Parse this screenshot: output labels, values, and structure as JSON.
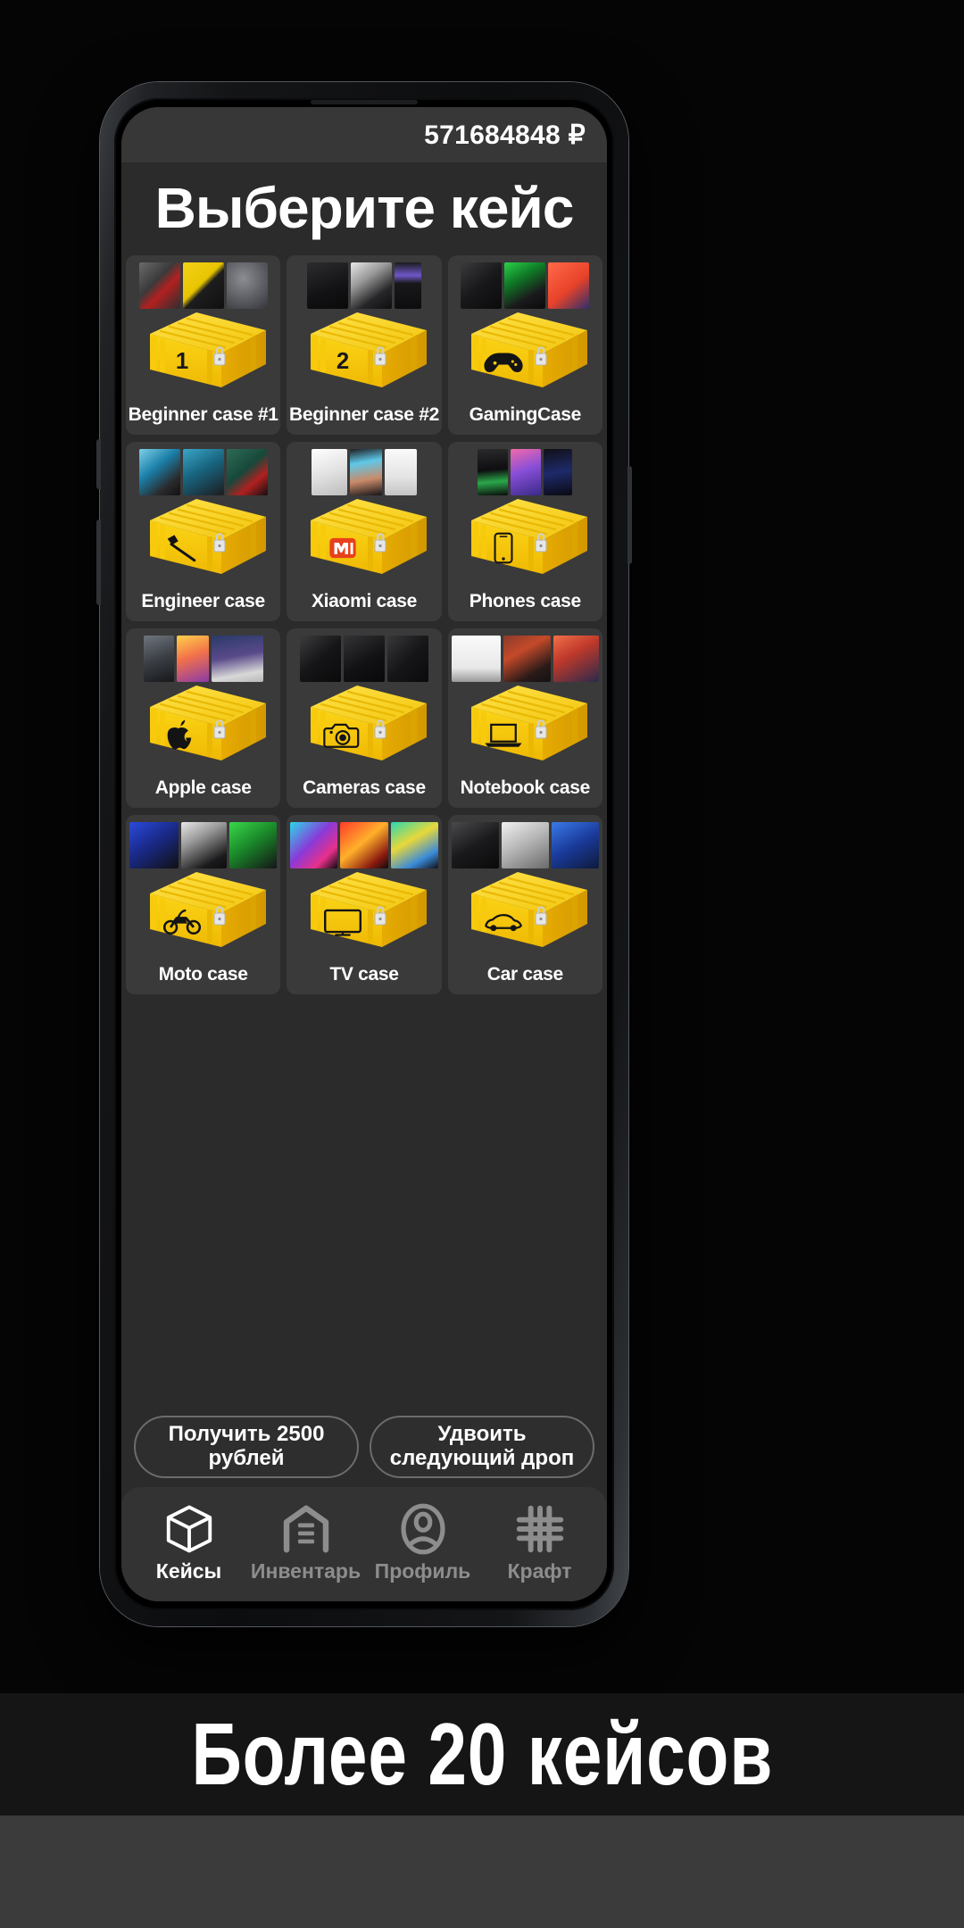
{
  "app": {
    "balance": "571684848 ₽",
    "screen_title": "Выберите кейс"
  },
  "colors": {
    "screen_bg": "#2b2b2b",
    "card_bg": "#3a3a3a",
    "statusbar_bg": "#373737",
    "navbar_bg": "#333333",
    "case_yellow": "#f5cc12",
    "case_yellow_light": "#ffd91f",
    "case_yellow_dark": "#e0a800",
    "text_primary": "#ffffff",
    "text_muted": "#8d8d8d",
    "promo_bg": "#151515"
  },
  "cases": [
    {
      "id": "beginner-1",
      "label": "Beginner case #1",
      "emblem": "number-1",
      "loot": [
        "glue-gun",
        "action-camera",
        "bluetooth-speaker"
      ]
    },
    {
      "id": "beginner-2",
      "label": "Beginner case #2",
      "emblem": "number-2",
      "loot": [
        "game-console",
        "vr-headset",
        "walkie-talkie"
      ]
    },
    {
      "id": "gaming",
      "label": "GamingCase",
      "emblem": "gamepad",
      "loot": [
        "speakers",
        "gaming-chair",
        "ps4-controller"
      ]
    },
    {
      "id": "engineer",
      "label": "Engineer case",
      "emblem": "hammer",
      "loot": [
        "drill",
        "hammer-drill",
        "glue-gun-green"
      ]
    },
    {
      "id": "xiaomi",
      "label": "Xiaomi case",
      "emblem": "mi-logo",
      "loot": [
        "earbuds",
        "mi-phone",
        "air-purifier"
      ]
    },
    {
      "id": "phones",
      "label": "Phones case",
      "emblem": "smartphone",
      "loot": [
        "black-shark",
        "galaxy-a50",
        "mi-mix"
      ]
    },
    {
      "id": "apple",
      "label": "Apple case",
      "emblem": "apple-logo",
      "loot": [
        "iphone",
        "ipad",
        "imac"
      ]
    },
    {
      "id": "cameras",
      "label": "Cameras case",
      "emblem": "camera",
      "loot": [
        "dslr-1",
        "dslr-2",
        "dslr-3"
      ]
    },
    {
      "id": "notebook",
      "label": "Notebook case",
      "emblem": "laptop",
      "loot": [
        "alienware",
        "gaming-laptop",
        "ultrabook"
      ]
    },
    {
      "id": "moto",
      "label": "Moto case",
      "emblem": "motorcycle",
      "loot": [
        "sportbike",
        "naked-bike",
        "dirt-bike"
      ]
    },
    {
      "id": "tv",
      "label": "TV case",
      "emblem": "television",
      "loot": [
        "tv-ink",
        "tv-flower",
        "tv-landscape"
      ]
    },
    {
      "id": "car",
      "label": "Car case",
      "emblem": "sportscar",
      "loot": [
        "black-coupe",
        "silver-sports",
        "blue-sedan"
      ]
    }
  ],
  "actions": {
    "claim_label": "Получить 2500 рублей",
    "double_label": "Удвоить следующий дроп"
  },
  "nav": [
    {
      "id": "cases",
      "label": "Кейсы",
      "icon": "box-icon",
      "active": true
    },
    {
      "id": "inventory",
      "label": "Инвентарь",
      "icon": "warehouse-icon",
      "active": false
    },
    {
      "id": "profile",
      "label": "Профиль",
      "icon": "person-icon",
      "active": false
    },
    {
      "id": "craft",
      "label": "Крафт",
      "icon": "grid-hash-icon",
      "active": false
    }
  ],
  "promo": {
    "headline": "Более 20 кейсов"
  }
}
